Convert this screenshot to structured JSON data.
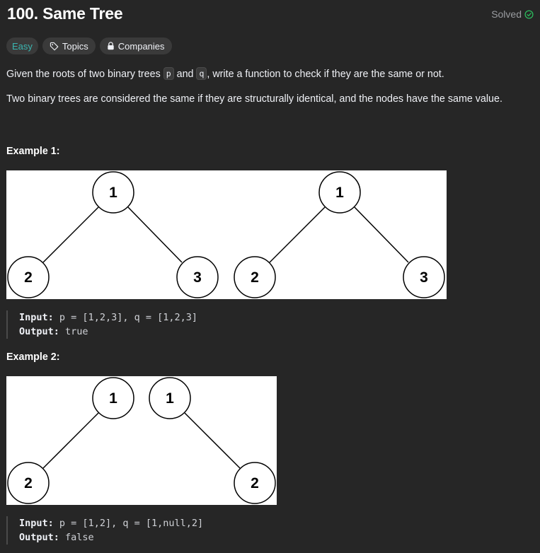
{
  "problem": {
    "title": "100. Same Tree",
    "status": "Solved"
  },
  "tags": {
    "difficulty": "Easy",
    "topics": "Topics",
    "companies": "Companies"
  },
  "description": {
    "line1_a": "Given the roots of two binary trees ",
    "p": "p",
    "line1_b": " and ",
    "q": "q",
    "line1_c": ", write a function to check if they are the same or not.",
    "line2": "Two binary trees are considered the same if they are structurally identical, and the nodes have the same value."
  },
  "examples": [
    {
      "title": "Example 1:",
      "input_label": "Input:",
      "input_value": "p = [1,2,3], q = [1,2,3]",
      "output_label": "Output:",
      "output_value": "true",
      "tree_nodes": [
        "1",
        "2",
        "3",
        "1",
        "2",
        "3"
      ]
    },
    {
      "title": "Example 2:",
      "input_label": "Input:",
      "input_value": "p = [1,2], q = [1,null,2]",
      "output_label": "Output:",
      "output_value": "false",
      "tree_nodes": [
        "1",
        "2",
        "1",
        "2"
      ]
    }
  ],
  "colors": {
    "background": "#262626",
    "easy": "#3ab5b0",
    "solved_check": "#2cbb5d"
  },
  "icons": [
    "check-circle-icon",
    "tag-icon",
    "lock-icon"
  ]
}
